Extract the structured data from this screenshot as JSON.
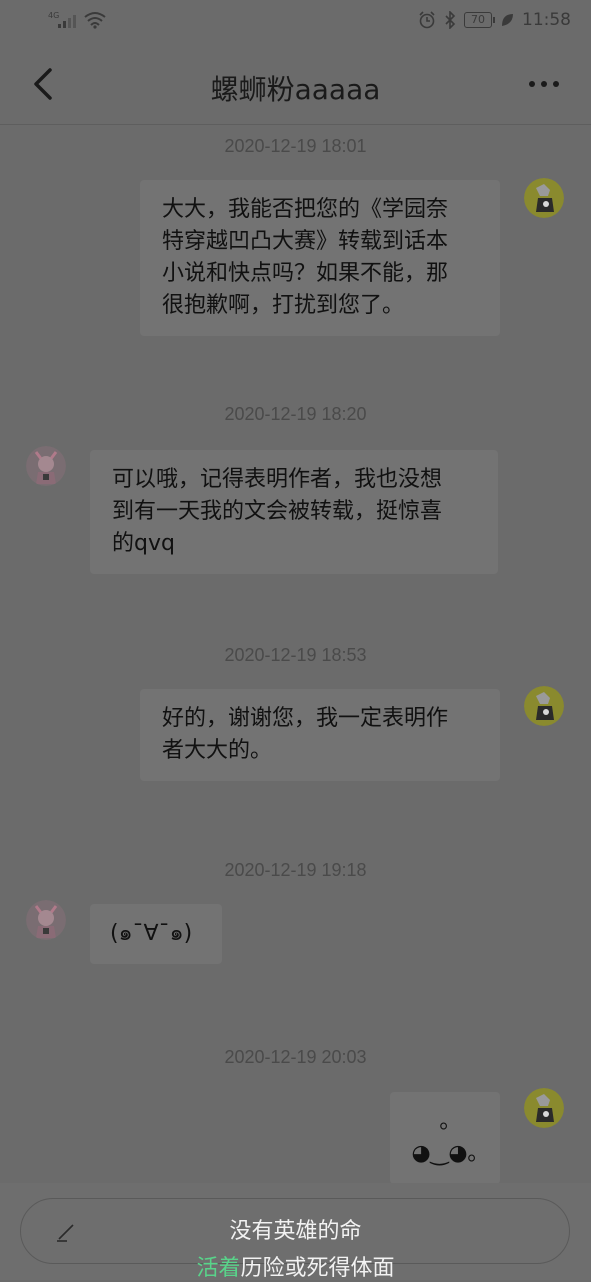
{
  "status_bar": {
    "network": "4G",
    "battery": "70",
    "time": "11:58",
    "icons": [
      "signal-icon",
      "wifi-icon",
      "alarm-icon",
      "bluetooth-icon",
      "battery-icon",
      "leaf-icon"
    ]
  },
  "header": {
    "title": "螺蛳粉aaaaa",
    "back_icon": "back-arrow-icon",
    "more_icon": "more-dots-icon"
  },
  "messages": [
    {
      "timestamp": "2020-12-19 18:01",
      "side": "right",
      "text": [
        "大大，我能否把您的《学园奈",
        "特穿越凹凸大赛》转载到话本",
        "小说和快点吗？如果不能，那",
        "很抱歉啊，打扰到您了。"
      ]
    },
    {
      "timestamp": "2020-12-19 18:20",
      "side": "left",
      "text": [
        "可以哦，记得表明作者，我也没想",
        "到有一天我的文会被转载，挺惊喜",
        "的qvq"
      ]
    },
    {
      "timestamp": "2020-12-19 18:53",
      "side": "right",
      "text": [
        "好的，谢谢您，我一定表明作",
        "者大大的。"
      ]
    },
    {
      "timestamp": "2020-12-19 19:18",
      "side": "left",
      "text": [
        "(๑¯∀¯๑)"
      ]
    },
    {
      "timestamp": "2020-12-19 20:03",
      "side": "right",
      "text": [
        "｡◕‿◕｡"
      ]
    }
  ],
  "lyrics": {
    "line1": "没有英雄的命",
    "line2_highlight": "活着",
    "line2_rest": "历险或死得体面",
    "highlight_color": "#59d38a"
  },
  "colors": {
    "overlay_bg": "#6b6b6b",
    "bubble": "#737373",
    "text": "#111111"
  }
}
